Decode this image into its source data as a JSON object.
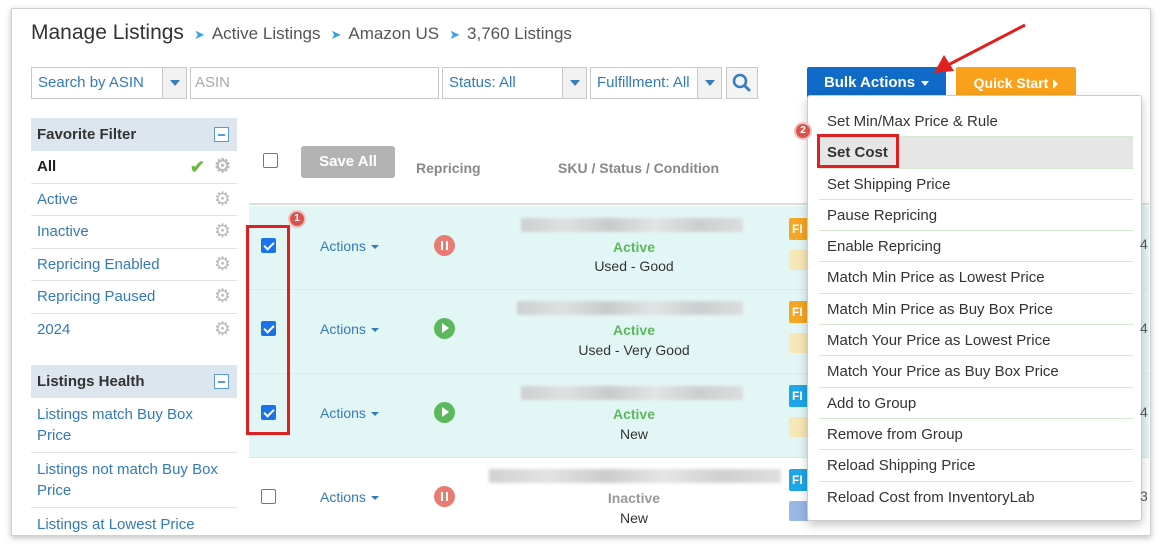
{
  "breadcrumb": {
    "title": "Manage Listings",
    "items": [
      "Active Listings",
      "Amazon US",
      "3,760 Listings"
    ]
  },
  "filters": {
    "search_by": "Search by ASIN",
    "asin_placeholder": "ASIN",
    "status": "Status: All",
    "fulfillment": "Fulfillment: All"
  },
  "buttons": {
    "bulk_actions": "Bulk Actions",
    "quick_start": "Quick Start",
    "save_all": "Save All"
  },
  "sidebar": {
    "favorite_title": "Favorite Filter",
    "favorite_items": [
      "All",
      "Active",
      "Inactive",
      "Repricing Enabled",
      "Repricing Paused",
      "2024"
    ],
    "health_title": "Listings Health",
    "health_items": [
      "Listings match Buy Box Price",
      "Listings not match Buy Box Price",
      "Listings at Lowest Price"
    ]
  },
  "table": {
    "headers": {
      "repricing": "Repricing",
      "sku": "SKU / Status / Condition"
    },
    "rows": [
      {
        "actions": "Actions",
        "repricing": "paused",
        "status": "Active",
        "condition": "Used - Good",
        "checked": true,
        "badge_color": "#f5a623",
        "badge": "FI"
      },
      {
        "actions": "Actions",
        "repricing": "running",
        "status": "Active",
        "condition": "Used - Very Good",
        "checked": true,
        "badge_color": "#f5a623",
        "badge": "FI"
      },
      {
        "actions": "Actions",
        "repricing": "running",
        "status": "Active",
        "condition": "New",
        "checked": true,
        "badge_color": "#1ea7e8",
        "badge": "FI"
      },
      {
        "actions": "Actions",
        "repricing": "paused",
        "status": "Inactive",
        "condition": "New",
        "checked": false,
        "badge_color": "#1ea7e8",
        "badge": "FI"
      }
    ],
    "edge_digits": [
      "4",
      "4",
      "4",
      "3"
    ]
  },
  "bulk_menu": {
    "items": [
      "Set Min/Max Price & Rule",
      "Set Cost",
      "Set Shipping Price",
      "Pause Repricing",
      "Enable Repricing",
      "Match Min Price as Lowest Price",
      "Match Min Price as Buy Box Price",
      "Match Your Price as Lowest Price",
      "Match Your Price as Buy Box Price",
      "Add to Group",
      "Remove from Group",
      "Reload Shipping Price",
      "Reload Cost from InventoryLab"
    ],
    "highlighted": "Set Cost"
  },
  "annotations": {
    "step1": "1",
    "step2": "2",
    "color": "#e02020"
  }
}
